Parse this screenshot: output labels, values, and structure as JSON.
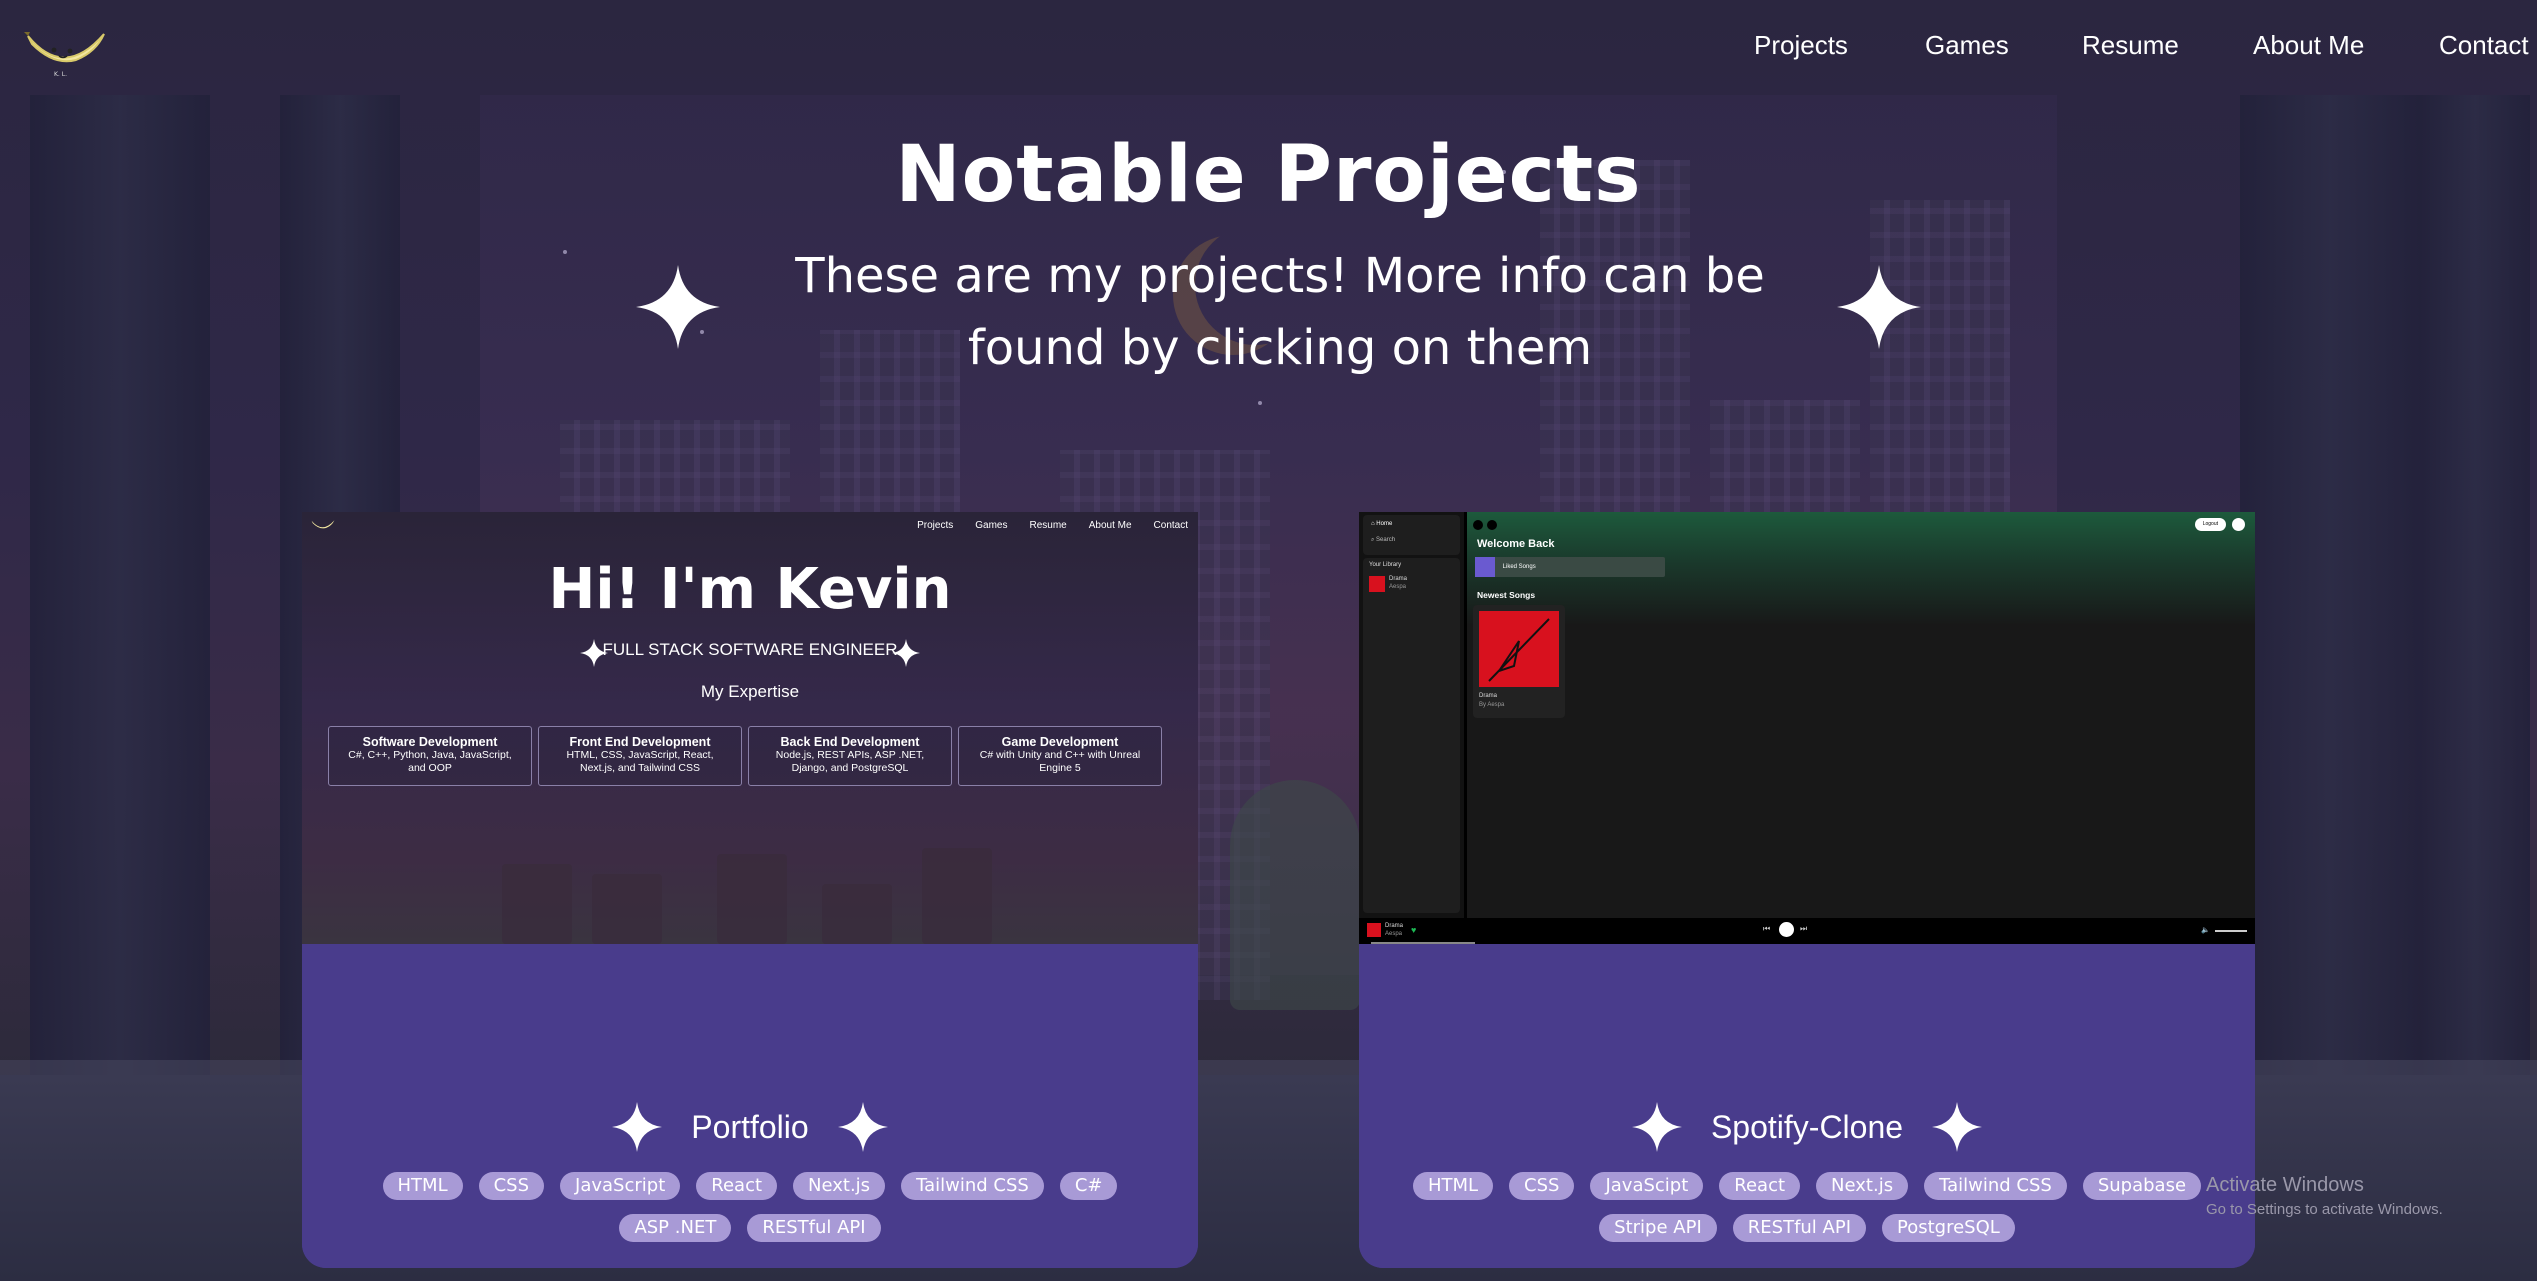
{
  "nav": {
    "logo_icon": "banana-logo-icon",
    "links": [
      "Projects",
      "Games",
      "Resume",
      "About Me",
      "Contact"
    ]
  },
  "header": {
    "title": "Notable Projects",
    "subtitle": "These are my projects! More info can be found by clicking on them"
  },
  "projects": [
    {
      "title": "Portfolio",
      "tags": [
        "HTML",
        "CSS",
        "JavaScript",
        "React",
        "Next.js",
        "Tailwind CSS",
        "C#",
        "ASP .NET",
        "RESTful API"
      ],
      "preview": {
        "nav": [
          "Projects",
          "Games",
          "Resume",
          "About Me",
          "Contact"
        ],
        "heading": "Hi! I'm Kevin",
        "role": "FULL STACK SOFTWARE ENGINEER",
        "expertise_label": "My Expertise",
        "boxes": [
          {
            "title": "Software Development",
            "desc": "C#, C++, Python, Java, JavaScript, and OOP"
          },
          {
            "title": "Front End Development",
            "desc": "HTML, CSS, JavaScript, React, Next.js, and Tailwind CSS"
          },
          {
            "title": "Back End Development",
            "desc": "Node.js, REST APIs, ASP .NET, Django, and PostgreSQL"
          },
          {
            "title": "Game Development",
            "desc": "C# with Unity and C++ with Unreal Engine 5"
          }
        ]
      }
    },
    {
      "title": "Spotify-Clone",
      "tags": [
        "HTML",
        "CSS",
        "JavaScipt",
        "React",
        "Next.js",
        "Tailwind CSS",
        "Supabase",
        "Stripe API",
        "RESTful API",
        "PostgreSQL"
      ],
      "preview": {
        "home": "Home",
        "search": "Search",
        "library": "Your Library",
        "side_song": "Drama",
        "side_artist": "Aespa",
        "welcome": "Welcome Back",
        "liked": "Liked Songs",
        "newest": "Newest Songs",
        "song_title": "Drama",
        "song_artist": "By Aespa",
        "logout": "Logout",
        "player_song": "Drama",
        "player_artist": "Aespa"
      }
    }
  ],
  "watermark": {
    "line1": "Activate Windows",
    "line2": "Go to Settings to activate Windows."
  },
  "colors": {
    "background": "#2b2540",
    "card": "#493c8c",
    "tag": "#a89ad6",
    "spotify_green": "#1db954"
  }
}
